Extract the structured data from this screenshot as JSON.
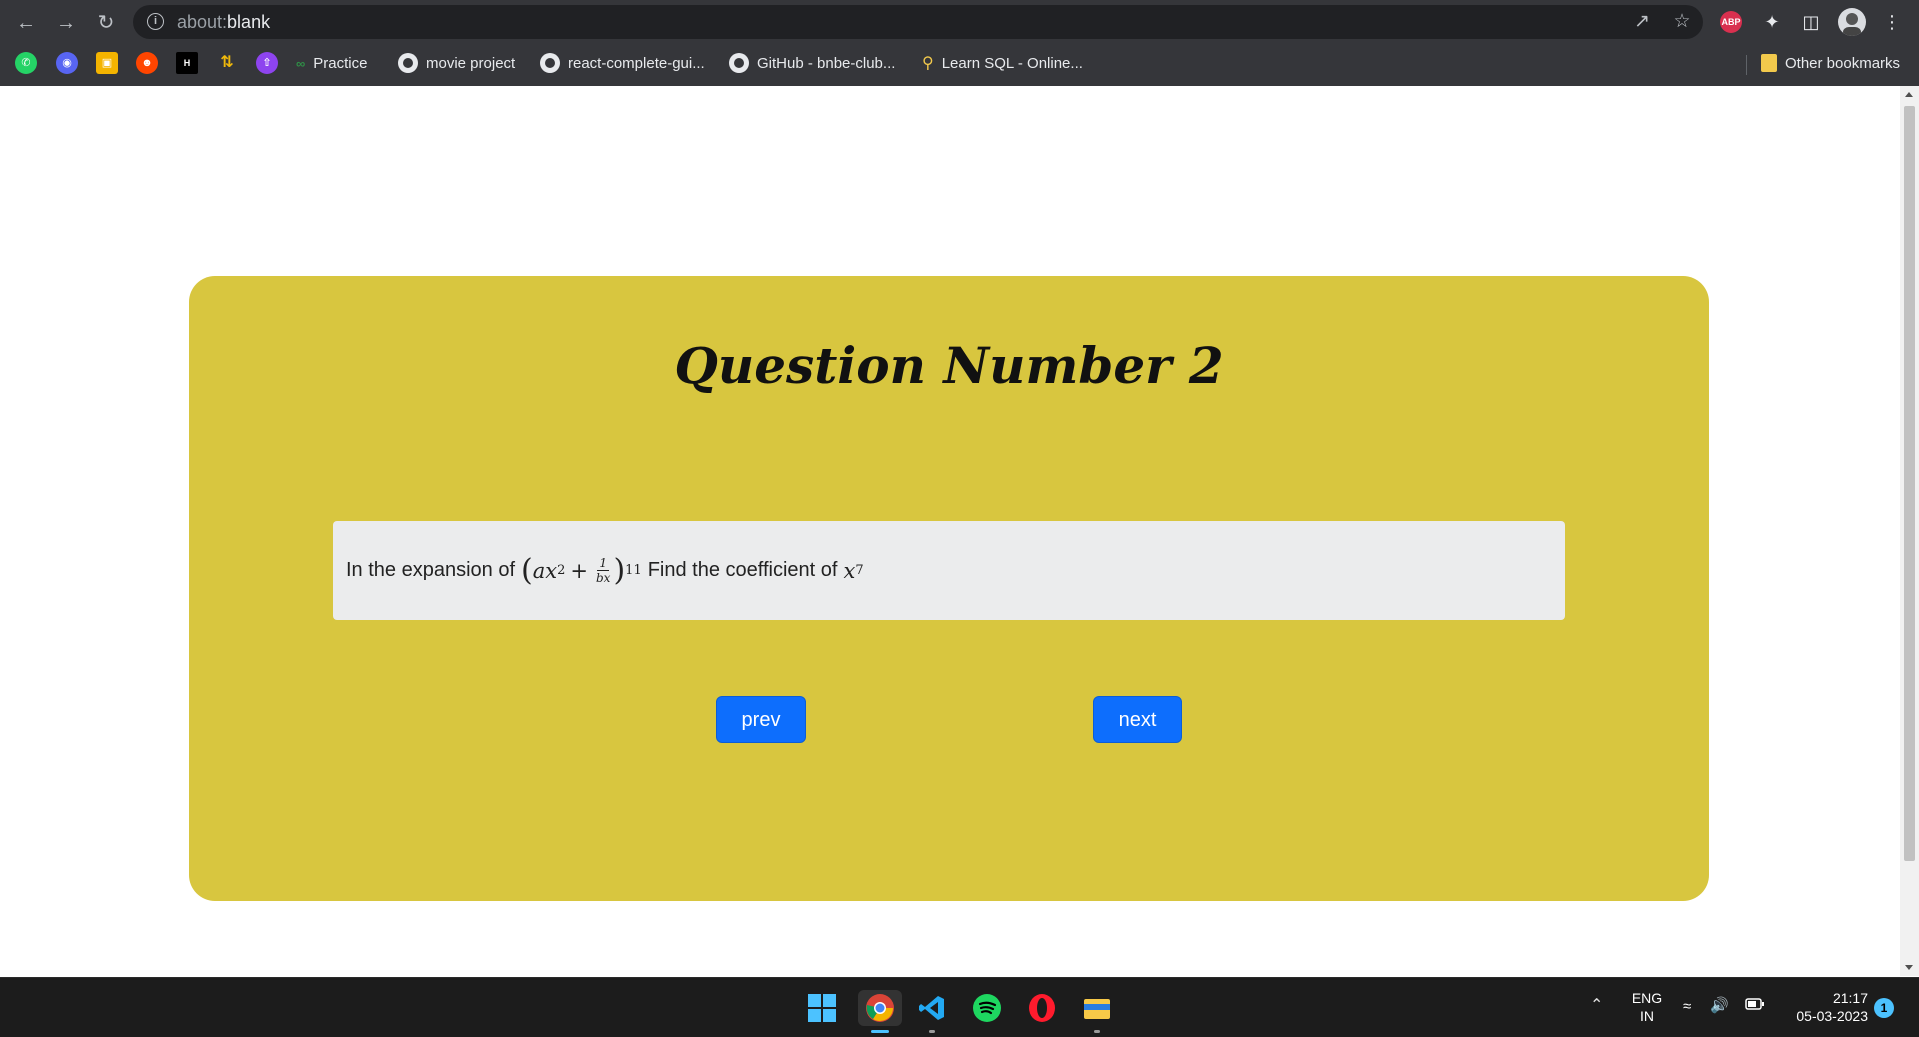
{
  "browser": {
    "url_prefix": "about:",
    "url_host": "blank",
    "bookmarks": [
      {
        "label": "Practice"
      },
      {
        "label": "movie project"
      },
      {
        "label": "react-complete-gui..."
      },
      {
        "label": "GitHub - bnbe-club..."
      },
      {
        "label": "Learn SQL - Online..."
      }
    ],
    "other_bookmarks": "Other bookmarks",
    "abp_label": "ABP"
  },
  "question": {
    "title": "Question Number 2",
    "text_before": "In the expansion of",
    "math_expression": "(ax^2 + 1/(bx))^11",
    "math_base": "ax",
    "math_power_inner": "2",
    "math_plus": "+",
    "math_frac_num": "1",
    "math_frac_den": "bx",
    "math_power_outer": "11",
    "text_after": "Find the coefficient of",
    "target_var": "x",
    "target_power": "7"
  },
  "buttons": {
    "prev": "prev",
    "next": "next"
  },
  "taskbar": {
    "lang_line1": "ENG",
    "lang_line2": "IN",
    "time": "21:17",
    "date": "05-03-2023",
    "notifications": "1"
  },
  "colors": {
    "card": "#d8c63f",
    "question_box": "#ebeced",
    "button": "#0d6efd"
  }
}
